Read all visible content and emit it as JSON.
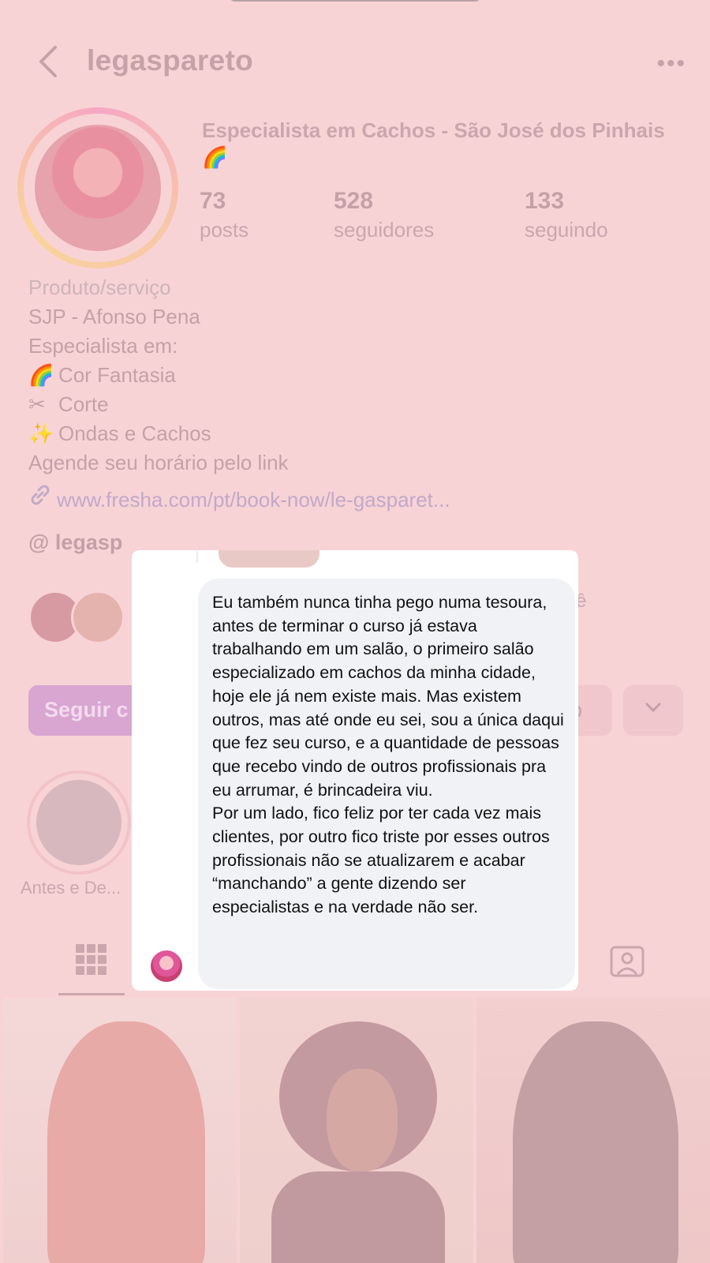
{
  "header": {
    "username": "legaspareto",
    "back_icon": "chevron-left-icon",
    "more_icon": "more-horizontal-icon"
  },
  "profile": {
    "title": "Especialista em Cachos - São José dos Pinhais 🌈",
    "stats": [
      {
        "value": "73",
        "label": "posts"
      },
      {
        "value": "528",
        "label": "seguidores"
      },
      {
        "value": "133",
        "label": "seguindo"
      }
    ],
    "bio": {
      "category": "Produto/serviço",
      "lines": [
        "SJP - Afonso Pena",
        "Especialista em:"
      ],
      "specialties": [
        {
          "emoji": "🌈",
          "text": "Cor Fantasia"
        },
        {
          "emoji": "✂",
          "text": "Corte"
        },
        {
          "emoji": "✨",
          "text": "Ondas e Cachos"
        }
      ],
      "cta": "Agende seu horário pelo link"
    },
    "link": "www.fresha.com/pt/book-now/le-gasparet...",
    "threads_handle": "legasp",
    "mutual_fragment": "cê"
  },
  "actions": {
    "follow_label": "Seguir c",
    "button_fragment": "p",
    "dropdown_icon": "chevron-down-icon"
  },
  "highlights": [
    {
      "label": "Antes e De..."
    }
  ],
  "tabs": {
    "grid_icon": "grid-icon",
    "tagged_icon": "tagged-user-icon"
  },
  "dialog": {
    "message": "Eu também nunca tinha pego numa tesoura, antes de terminar o curso já estava trabalhando em um salão, o primeiro salão especializado em cachos da minha cidade, hoje ele já nem existe mais. Mas existem outros, mas até onde eu sei, sou a única daqui que fez seu curso, e a quantidade de pessoas que recebo vindo de outros profissionais pra eu arrumar, é brincadeira viu.\nPor um lado, fico feliz por ter cada vez mais clientes, por outro fico triste por esses outros profissionais não se atualizarem e acabar “manchando” a gente dizendo ser especialistas e na verdade não ser."
  },
  "colors": {
    "overlay_pink": "#f8d3d6",
    "bubble_gray": "#f1f2f6",
    "dialog_white": "#ffffff",
    "follow_button": "#d8a6d1"
  }
}
